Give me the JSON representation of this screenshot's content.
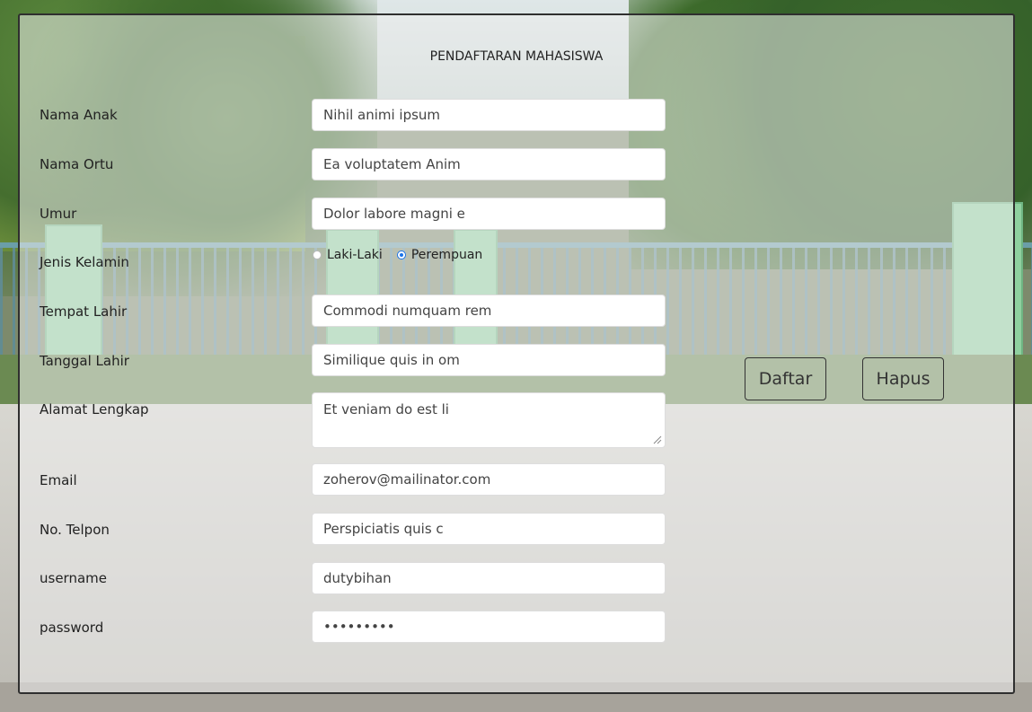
{
  "form": {
    "title": "PENDAFTARAN MAHASISWA",
    "fields": [
      {
        "label": "Nama Anak",
        "value": "Nihil animi ipsum"
      },
      {
        "label": "Nama Ortu",
        "value": "Ea voluptatem Anim"
      },
      {
        "label": "Umur",
        "value": "Dolor labore magni e"
      },
      {
        "label": "Jenis Kelamin",
        "options": [
          "Laki-Laki",
          "Perempuan"
        ],
        "selected": "Perempuan"
      },
      {
        "label": "Tempat Lahir",
        "value": "Commodi numquam rem"
      },
      {
        "label": "Tanggal Lahir",
        "value": "Similique quis in om"
      },
      {
        "label": "Alamat Lengkap",
        "value": "Et veniam do est li"
      },
      {
        "label": "Email",
        "value": "zoherov@mailinator.com"
      },
      {
        "label": "No. Telpon",
        "value": "Perspiciatis quis c"
      },
      {
        "label": "username",
        "value": "dutybihan"
      },
      {
        "label": "password",
        "value": "•••••••••"
      }
    ],
    "buttons": {
      "submit": "Daftar",
      "reset": "Hapus"
    }
  },
  "colors": {
    "radio_selected": "#1a73e8"
  }
}
